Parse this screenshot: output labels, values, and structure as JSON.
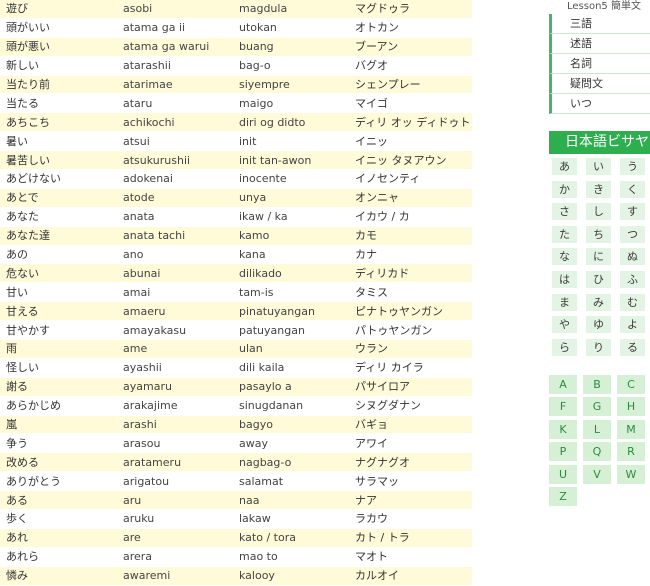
{
  "vocab_rows": [
    [
      "遊び",
      "asobi",
      "magdula",
      "マグドゥラ"
    ],
    [
      "頭がいい",
      "atama ga ii",
      "utokan",
      "オトカン"
    ],
    [
      "頭が悪い",
      "atama ga warui",
      "buang",
      "ブーアン"
    ],
    [
      "新しい",
      "atarashii",
      "bag-o",
      "バグオ"
    ],
    [
      "当たり前",
      "atarimae",
      "siyempre",
      "シェンプレー"
    ],
    [
      "当たる",
      "ataru",
      "maigo",
      "マイゴ"
    ],
    [
      "あちこち",
      "achikochi",
      "diri og didto",
      "ディリ オッ ディドゥト"
    ],
    [
      "暑い",
      "atsui",
      "init",
      "イニッ"
    ],
    [
      "暑苦しい",
      "atsukurushii",
      "init tan-awon",
      "イニッ タヌアウン"
    ],
    [
      "あどけない",
      "adokenai",
      "inocente",
      "イノセンティ"
    ],
    [
      "あとで",
      "atode",
      "unya",
      "オンニャ"
    ],
    [
      "あなた",
      "anata",
      "ikaw / ka",
      "イカウ / カ"
    ],
    [
      "あなた達",
      "anata tachi",
      "kamo",
      "カモ"
    ],
    [
      "あの",
      "ano",
      "kana",
      "カナ"
    ],
    [
      "危ない",
      "abunai",
      "dilikado",
      "ディリカド"
    ],
    [
      "甘い",
      "amai",
      "tam-is",
      "タミス"
    ],
    [
      "甘える",
      "amaeru",
      "pinatuyangan",
      "ピナトゥヤンガン"
    ],
    [
      "甘やかす",
      "amayakasu",
      "patuyangan",
      "パトゥヤンガン"
    ],
    [
      "雨",
      "ame",
      "ulan",
      "ウラン"
    ],
    [
      "怪しい",
      "ayashii",
      "dili kaila",
      "ディリ カイラ"
    ],
    [
      "謝る",
      "ayamaru",
      "pasaylo a",
      "パサイロア"
    ],
    [
      "あらかじめ",
      "arakajime",
      "sinugdanan",
      "シヌグダナン"
    ],
    [
      "嵐",
      "arashi",
      "bagyo",
      "バギョ"
    ],
    [
      "争う",
      "arasou",
      "away",
      "アワイ"
    ],
    [
      "改める",
      "aratameru",
      "nagbag-o",
      "ナグナグオ"
    ],
    [
      "ありがとう",
      "arigatou",
      "salamat",
      "サラマッ"
    ],
    [
      "ある",
      "aru",
      "naa",
      "ナア"
    ],
    [
      "歩く",
      "aruku",
      "lakaw",
      "ラカウ"
    ],
    [
      "あれ",
      "are",
      "kato / tora",
      "カト / トラ"
    ],
    [
      "あれら",
      "arera",
      "mao to",
      "マオト"
    ],
    [
      "憐み",
      "awaremi",
      "kalooy",
      "カルオイ"
    ]
  ],
  "sidebar": {
    "lesson_link": "Lesson5 簡単文",
    "menu": [
      "三語",
      "述語",
      "名詞",
      "疑問文",
      "いつ"
    ],
    "dict_header": "日本語ビサヤ",
    "kana": [
      [
        "あ",
        "い",
        "う"
      ],
      [
        "か",
        "き",
        "く"
      ],
      [
        "さ",
        "し",
        "す"
      ],
      [
        "た",
        "ち",
        "つ"
      ],
      [
        "な",
        "に",
        "ぬ"
      ],
      [
        "は",
        "ひ",
        "ふ"
      ],
      [
        "ま",
        "み",
        "む"
      ],
      [
        "や",
        "ゆ",
        "よ"
      ],
      [
        "ら",
        "り",
        "る"
      ]
    ],
    "alphabet": [
      [
        "A",
        "B",
        "C"
      ],
      [
        "F",
        "G",
        "H"
      ],
      [
        "K",
        "L",
        "M"
      ],
      [
        "P",
        "Q",
        "R"
      ],
      [
        "U",
        "V",
        "W"
      ],
      [
        "Z"
      ]
    ]
  },
  "colors": {
    "row_highlight": "#fffbd9",
    "accent_green": "#2fae4f",
    "kana_bg": "#e4f4e4",
    "alpha_bg": "#d6f0d6"
  }
}
